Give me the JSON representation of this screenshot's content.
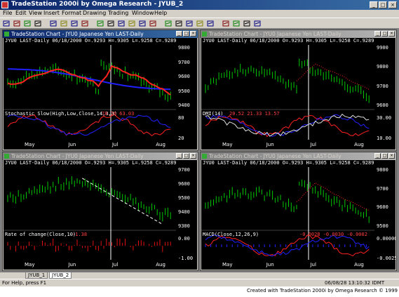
{
  "app": {
    "title": "TradeStation 2000i by Omega Research - JYUB_2"
  },
  "menu": [
    "File",
    "Edit",
    "View",
    "Insert",
    "Format",
    "Drawing",
    "Trading",
    "Window",
    "Help"
  ],
  "windows": [
    {
      "title": "TradeStation Chart - JYU0 Japanese Yen LAST-Daily",
      "header": "JYU0 LAST-Daily  06/18/2000  O=.9293  H=.9305  L=.9258  C=.9289",
      "indicator": "Stochastic Slow(High,Low,Close,14,3,3)",
      "ind_values": "78.26   63.03",
      "yticks": [
        "9800",
        "9700",
        "9600",
        "9500",
        "9400"
      ],
      "ind_ticks": [
        "80",
        "20"
      ],
      "xticks": [
        "May",
        "Jun",
        "Jul",
        "Aug"
      ]
    },
    {
      "title": "TradeStation Chart - JYU0 Japanese Yen LAST-Daily",
      "header": "JYU0 LAST-Daily  06/18/2000  O=.9293  H=.9305  L=.9258  C=.9289",
      "indicator": "DMI(14)",
      "ind_values": "20.52   21.33   13.57",
      "yticks": [
        "9900",
        "9800",
        "9700",
        "9600"
      ],
      "ind_ticks": [
        "30.00",
        "10.00"
      ],
      "xticks": [
        "May",
        "Jun",
        "Jul",
        "Aug"
      ]
    },
    {
      "title": "TradeStation Chart - JYU0 Japanese Yen LAST-Daily",
      "header": "JYU0 LAST-Daily  06/18/2000  O=.9293  H=.9305  L=.9258  C=.9289",
      "indicator": "Rate of change(Close,10)",
      "ind_values": "-1.38",
      "yticks": [
        "9700",
        "9600",
        "9500",
        "9400",
        "9300"
      ],
      "ind_ticks": [
        "0.00",
        "-1.00"
      ],
      "xticks": [
        "May",
        "Jun",
        "Jul",
        "Aug"
      ]
    },
    {
      "title": "TradeStation Chart - JYU0 Japanese Yen LAST-Daily",
      "header": "JYU0 LAST-Daily  06/18/2000  O=.9293  H=.9305  L=.9258  C=.9289",
      "indicator": "MACD(Close,12,26,9)",
      "ind_values": "-0.0028   -0.0030   -0.0002",
      "yticks": [
        "9800",
        "9700",
        "9600",
        "9500"
      ],
      "ind_ticks": [
        "0.00000",
        "-0.00250"
      ],
      "xticks": [
        "May",
        "Jun",
        "Jul",
        "Aug"
      ]
    }
  ],
  "tabs": [
    "JYUB_1",
    "JYUB_2"
  ],
  "status": {
    "help": "For Help, press F1",
    "datetime": "06/08/28 13:10:32 IDMT"
  },
  "credit": "Created with TradeStation 2000i by Omega Research © 1999"
}
